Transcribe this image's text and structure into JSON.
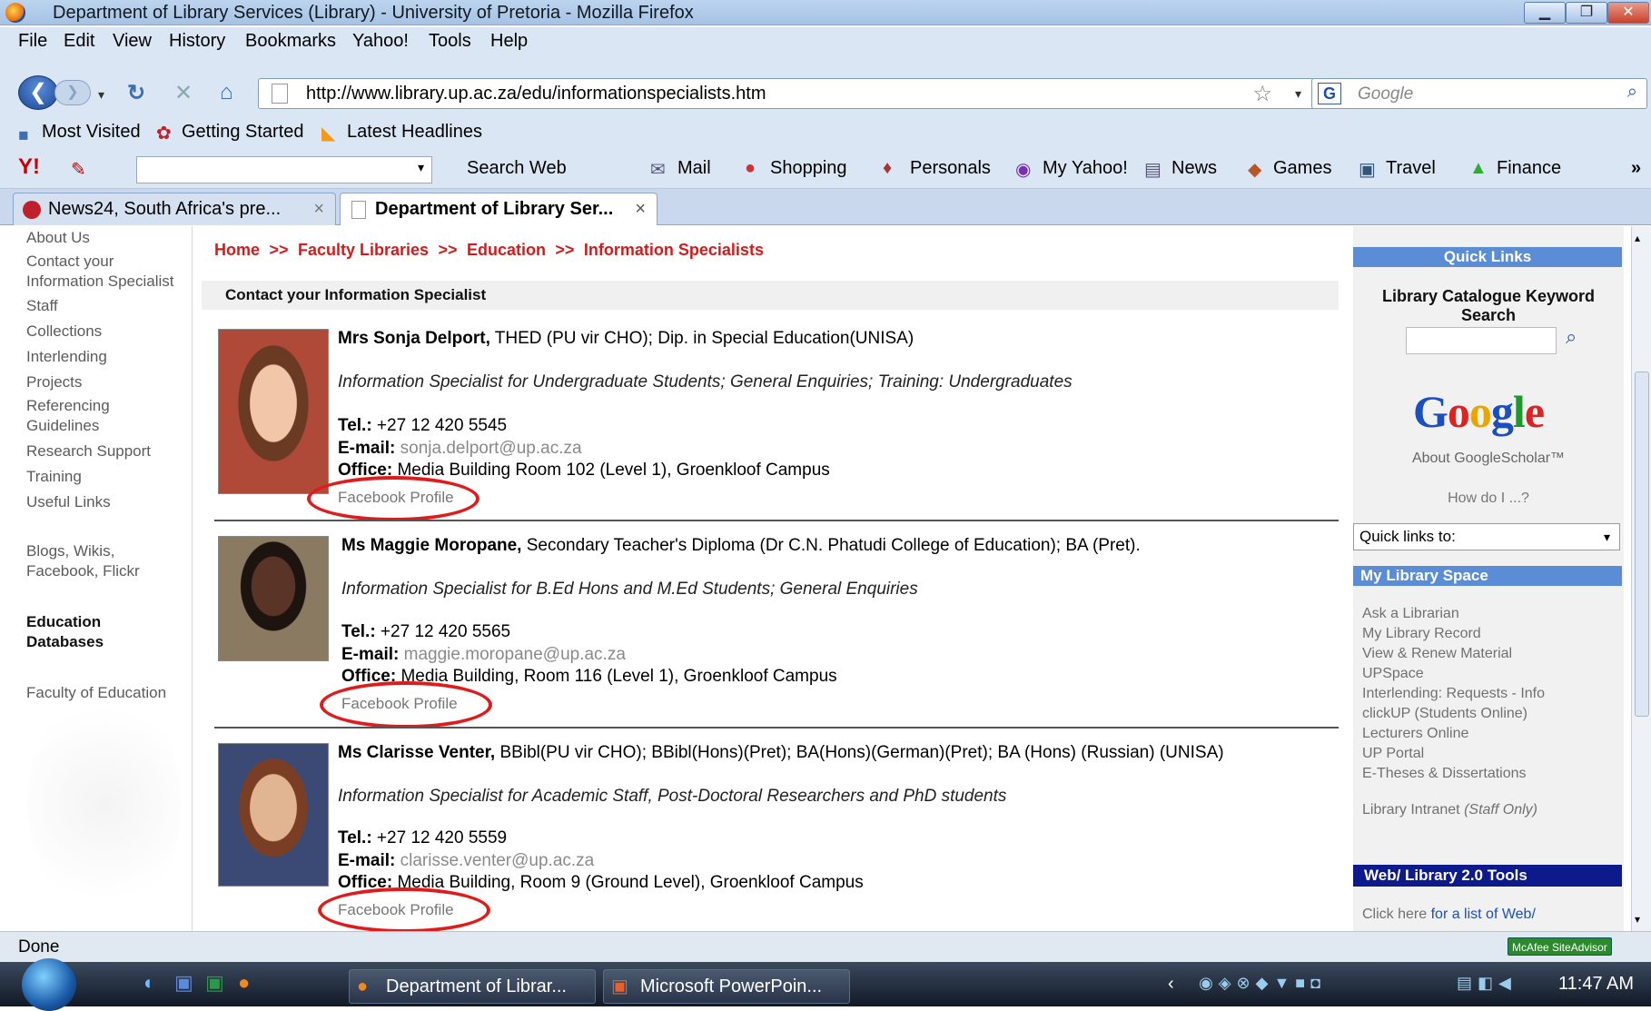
{
  "window": {
    "title": "Department of Library Services (Library) - University of Pretoria - Mozilla Firefox"
  },
  "menu": [
    "File",
    "Edit",
    "View",
    "History",
    "Bookmarks",
    "Yahoo!",
    "Tools",
    "Help"
  ],
  "nav": {
    "url": "http://www.library.up.ac.za/edu/informationspecialists.htm",
    "search_placeholder": "Google"
  },
  "bookmarks": [
    "Most Visited",
    "Getting Started",
    "Latest Headlines"
  ],
  "yahoo_toolbar": {
    "search_web": "Search Web",
    "items": [
      "Mail",
      "Shopping",
      "Personals",
      "My Yahoo!",
      "News",
      "Games",
      "Travel",
      "Finance"
    ]
  },
  "tabs": [
    "News24, South Africa's pre...",
    "Department of Library Ser..."
  ],
  "left_nav": {
    "items": [
      "About Us",
      "Contact your Information Specialist",
      "Staff",
      "Collections",
      "Interlending",
      "Projects",
      "Referencing Guidelines",
      "Research Support",
      "Training",
      "Useful Links"
    ],
    "blogs": "Blogs, Wikis, Facebook, Flickr",
    "education_databases": "Education Databases",
    "faculty": "Faculty of Education"
  },
  "breadcrumb": [
    "Home",
    ">>",
    "Faculty Libraries",
    ">>",
    "Education",
    ">>",
    "Information Specialists"
  ],
  "section_title": "Contact your Information Specialist",
  "labels": {
    "tel": "Tel.:",
    "email": "E-mail:",
    "office": "Office:",
    "facebook": "Facebook Profile"
  },
  "specialists": [
    {
      "name": "Mrs Sonja Delport,",
      "quals": " THED (PU vir CHO); Dip. in Special Education(UNISA)",
      "role": "Information Specialist for Undergraduate Students; General Enquiries; Training: Undergraduates",
      "tel": " +27 12 420 5545",
      "email": "sonja.delport@up.ac.za",
      "office": "Media Building Room 102 (Level 1), Groenkloof Campus"
    },
    {
      "name": "Ms Maggie Moropane,",
      "quals": " Secondary Teacher's Diploma (Dr C.N. Phatudi College of Education); BA (Pret).",
      "role": "Information Specialist for B.Ed Hons and M.Ed Students; General Enquiries",
      "tel": " +27 12 420 5565",
      "email": "maggie.moropane@up.ac.za",
      "office": "Media Building, Room 116 (Level 1), Groenkloof Campus"
    },
    {
      "name": "Ms Clarisse Venter,",
      "quals": " BBibl(PU vir CHO); BBibl(Hons)(Pret); BA(Hons)(German)(Pret); BA (Hons) (Russian) (UNISA)",
      "role": "Information Specialist for Academic Staff, Post-Doctoral Researchers and PhD students",
      "tel": " +27 12 420 5559",
      "email": "clarisse.venter@up.ac.za",
      "office": "Media Building, Room 9 (Ground Level), Groenkloof Campus"
    }
  ],
  "right": {
    "quick_links": "Quick Links",
    "catalogue": "Library Catalogue Keyword Search",
    "about_scholar": "About GoogleScholar™",
    "how_do_i": "How do I ...?",
    "quick_links_select": "Quick links to:",
    "my_library_space": "My Library Space",
    "space_links": [
      "Ask a Librarian",
      "My Library Record",
      "View & Renew Material",
      "UPSpace",
      "Interlending: Requests  -  Info",
      "clickUP (Students Online)",
      "Lecturers Online",
      "UP Portal",
      "E-Theses & Dissertations"
    ],
    "intranet": "Library Intranet",
    "intranet_note": "(Staff Only)",
    "web_tools": "Web/ Library 2.0 Tools",
    "click_here": "Click here",
    "click_here_link": "for a list of Web/"
  },
  "status": {
    "text": "Done",
    "mcafee": "McAfee SiteAdvisor"
  },
  "taskbar": {
    "items": [
      "Department of Librar...",
      "Microsoft PowerPoin..."
    ],
    "clock": "11:47 AM"
  }
}
